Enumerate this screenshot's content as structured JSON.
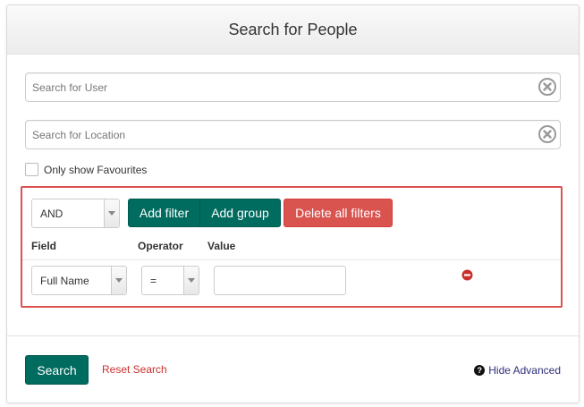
{
  "dialog": {
    "title": "Search for People"
  },
  "search_user": {
    "placeholder": "Search for User",
    "value": ""
  },
  "search_location": {
    "placeholder": "Search for Location",
    "value": ""
  },
  "favourites": {
    "label": "Only show Favourites",
    "checked": false
  },
  "filters": {
    "logic_selected": "AND",
    "add_filter_label": "Add filter",
    "add_group_label": "Add group",
    "delete_all_label": "Delete all filters",
    "columns": {
      "field": "Field",
      "operator": "Operator",
      "value": "Value"
    },
    "rows": [
      {
        "field": "Full Name",
        "operator": "=",
        "value": ""
      }
    ]
  },
  "footer": {
    "search_label": "Search",
    "reset_label": "Reset Search",
    "hide_advanced_label": "Hide Advanced",
    "help_icon_glyph": "?"
  },
  "colors": {
    "primary": "#006b5f",
    "danger": "#d9534f",
    "reset_link": "#c9302c",
    "hide_link": "#2e2e7a"
  },
  "icons": {
    "clear": "clear-circle-icon",
    "remove": "minus-circle-icon",
    "help": "question-circle-icon",
    "dropdown": "caret-down-icon"
  }
}
